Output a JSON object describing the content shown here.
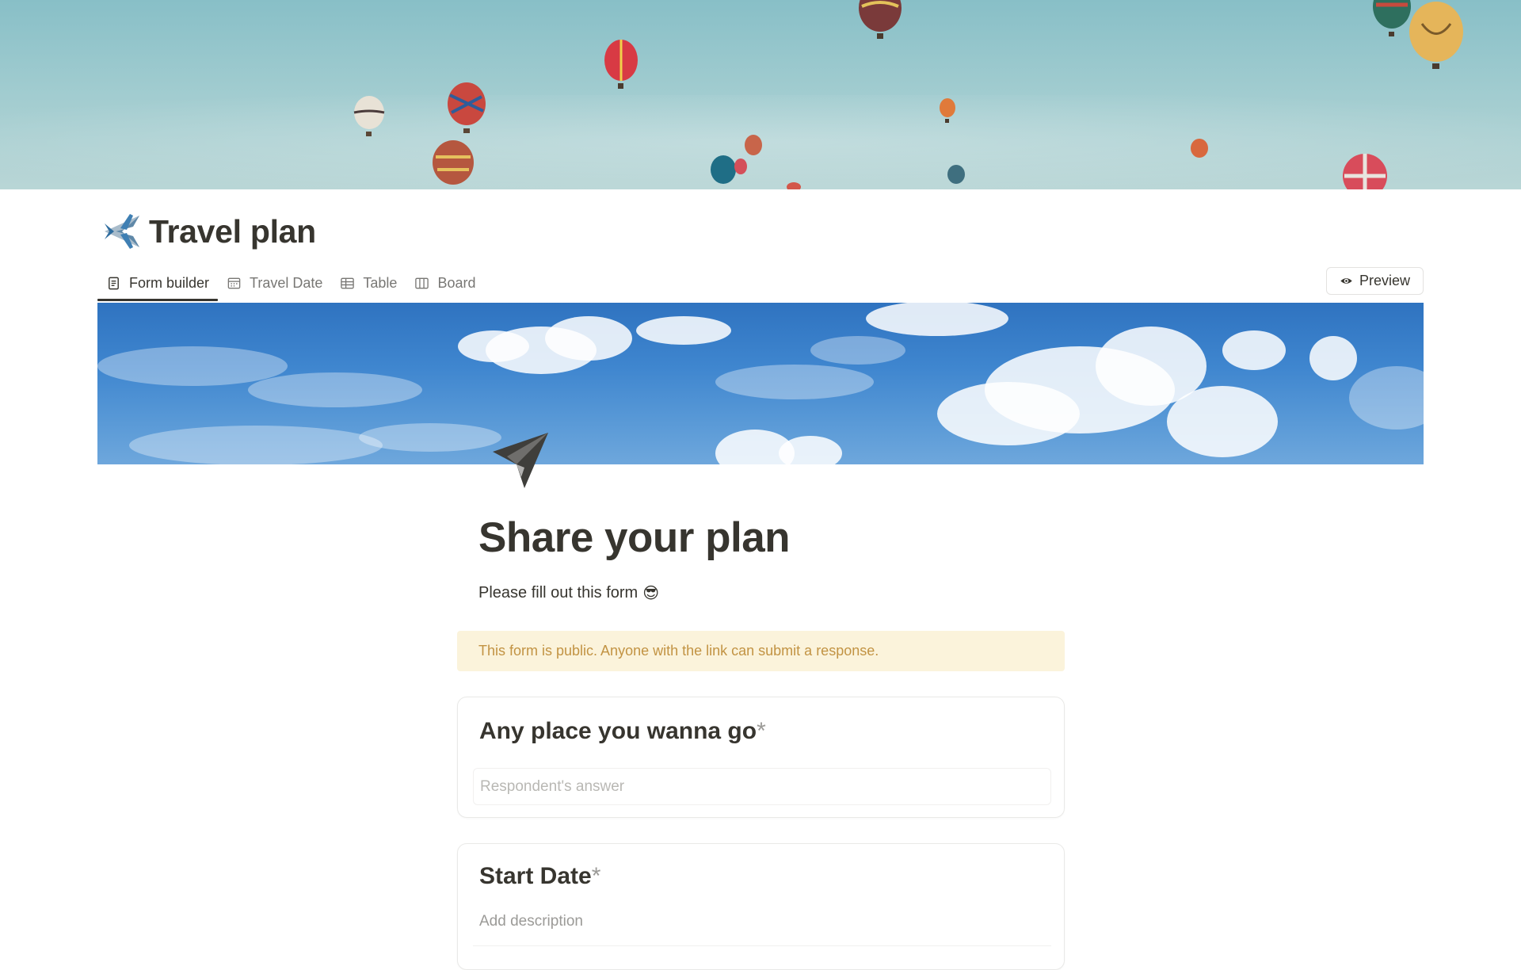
{
  "page": {
    "title": "Travel plan",
    "icon": "airplane-emoji"
  },
  "tabs": [
    {
      "label": "Form builder",
      "icon": "form-icon",
      "active": true
    },
    {
      "label": "Travel Date",
      "icon": "calendar-icon",
      "active": false
    },
    {
      "label": "Table",
      "icon": "table-icon",
      "active": false
    },
    {
      "label": "Board",
      "icon": "board-icon",
      "active": false
    }
  ],
  "toolbar": {
    "preview_label": "Preview",
    "preview_icon": "eye-icon"
  },
  "form": {
    "icon": "paper-plane-icon",
    "title": "Share your plan",
    "description": "Please fill out this form",
    "description_emoji": "😎",
    "notice": "This form is public. Anyone with the link can submit a response.",
    "questions": [
      {
        "title": "Any place you wanna go",
        "required_mark": "*",
        "placeholder": "Respondent's answer"
      },
      {
        "title": "Start Date",
        "required_mark": "*",
        "description_placeholder": "Add description"
      }
    ]
  },
  "colors": {
    "text": "#37352f",
    "muted": "#787774",
    "notice_bg": "#fbf3db",
    "notice_text": "#c29343",
    "border": "#e9e9e7"
  }
}
